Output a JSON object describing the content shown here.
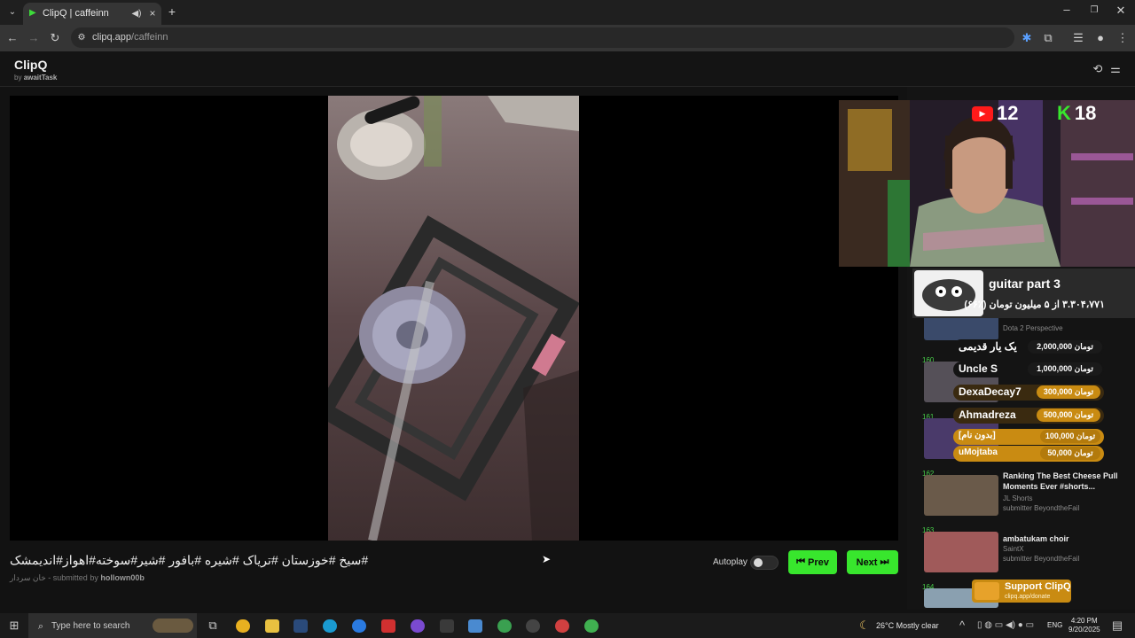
{
  "browser": {
    "tab_title": "ClipQ | caffeinn",
    "url_domain": "clipq.app",
    "url_path": "/caffeinn"
  },
  "app": {
    "title": "ClipQ",
    "by_prefix": "by",
    "by_author": "awaitTask"
  },
  "clip": {
    "title": "سیخ #خوزستان #تریاک #شیره #بافور #شیر#سوخته#اهواز#اندیمشک#",
    "channel": "خان سردار",
    "submitted_prefix": "- submitted by",
    "submitter": "hollown00b"
  },
  "controls": {
    "autoplay_label": "Autoplay",
    "prev_label": "Prev",
    "next_label": "Next"
  },
  "queue": [
    {
      "num": "",
      "title": "",
      "channel": "Dota 2 Perspective",
      "submitter": ""
    },
    {
      "num": "160",
      "title": "",
      "channel": "",
      "submitter": ""
    },
    {
      "num": "161",
      "title": "",
      "channel": "",
      "submitter": ""
    },
    {
      "num": "162",
      "title": "Ranking The Best Cheese Pull Moments Ever #shorts...",
      "channel": "JL Shorts",
      "submitter": "submitter BeyondtheFail"
    },
    {
      "num": "163",
      "title": "ambatukam choir",
      "channel": "SaintX",
      "submitter": "submitter BeyondtheFail"
    },
    {
      "num": "164",
      "title": "",
      "channel": "",
      "submitter": ""
    }
  ],
  "stream_overlay": {
    "youtube_viewers": "12",
    "kick_viewers": "18",
    "goal_title": "guitar part 3",
    "goal_progress": "۳.۳۰۴،۷۷۱ از ۵ میلیون تومان (٪۶۶)",
    "donations": [
      {
        "name": "یک یار قدیمی",
        "amount": "2,000,000 تومان"
      },
      {
        "name": "Uncle S",
        "amount": "1,000,000 تومان"
      },
      {
        "name": "DexaDecay7",
        "amount": "300,000 تومان"
      },
      {
        "name": "Ahmadreza",
        "amount": "500,000 تومان"
      },
      {
        "name": "[بدون نام]",
        "amount": "100,000 تومان"
      },
      {
        "name": "uMojtaba",
        "amount": "50,000 تومان"
      }
    ],
    "support_title": "Support ClipQ",
    "support_url": "clipq.app/donate"
  },
  "taskbar": {
    "search_placeholder": "Type here to search",
    "weather": "26°C  Mostly clear",
    "lang": "ENG",
    "time": "4:20 PM",
    "date": "9/20/2025"
  },
  "colors": {
    "accent_green": "#38e62d",
    "support_gold": "#c98b12"
  }
}
